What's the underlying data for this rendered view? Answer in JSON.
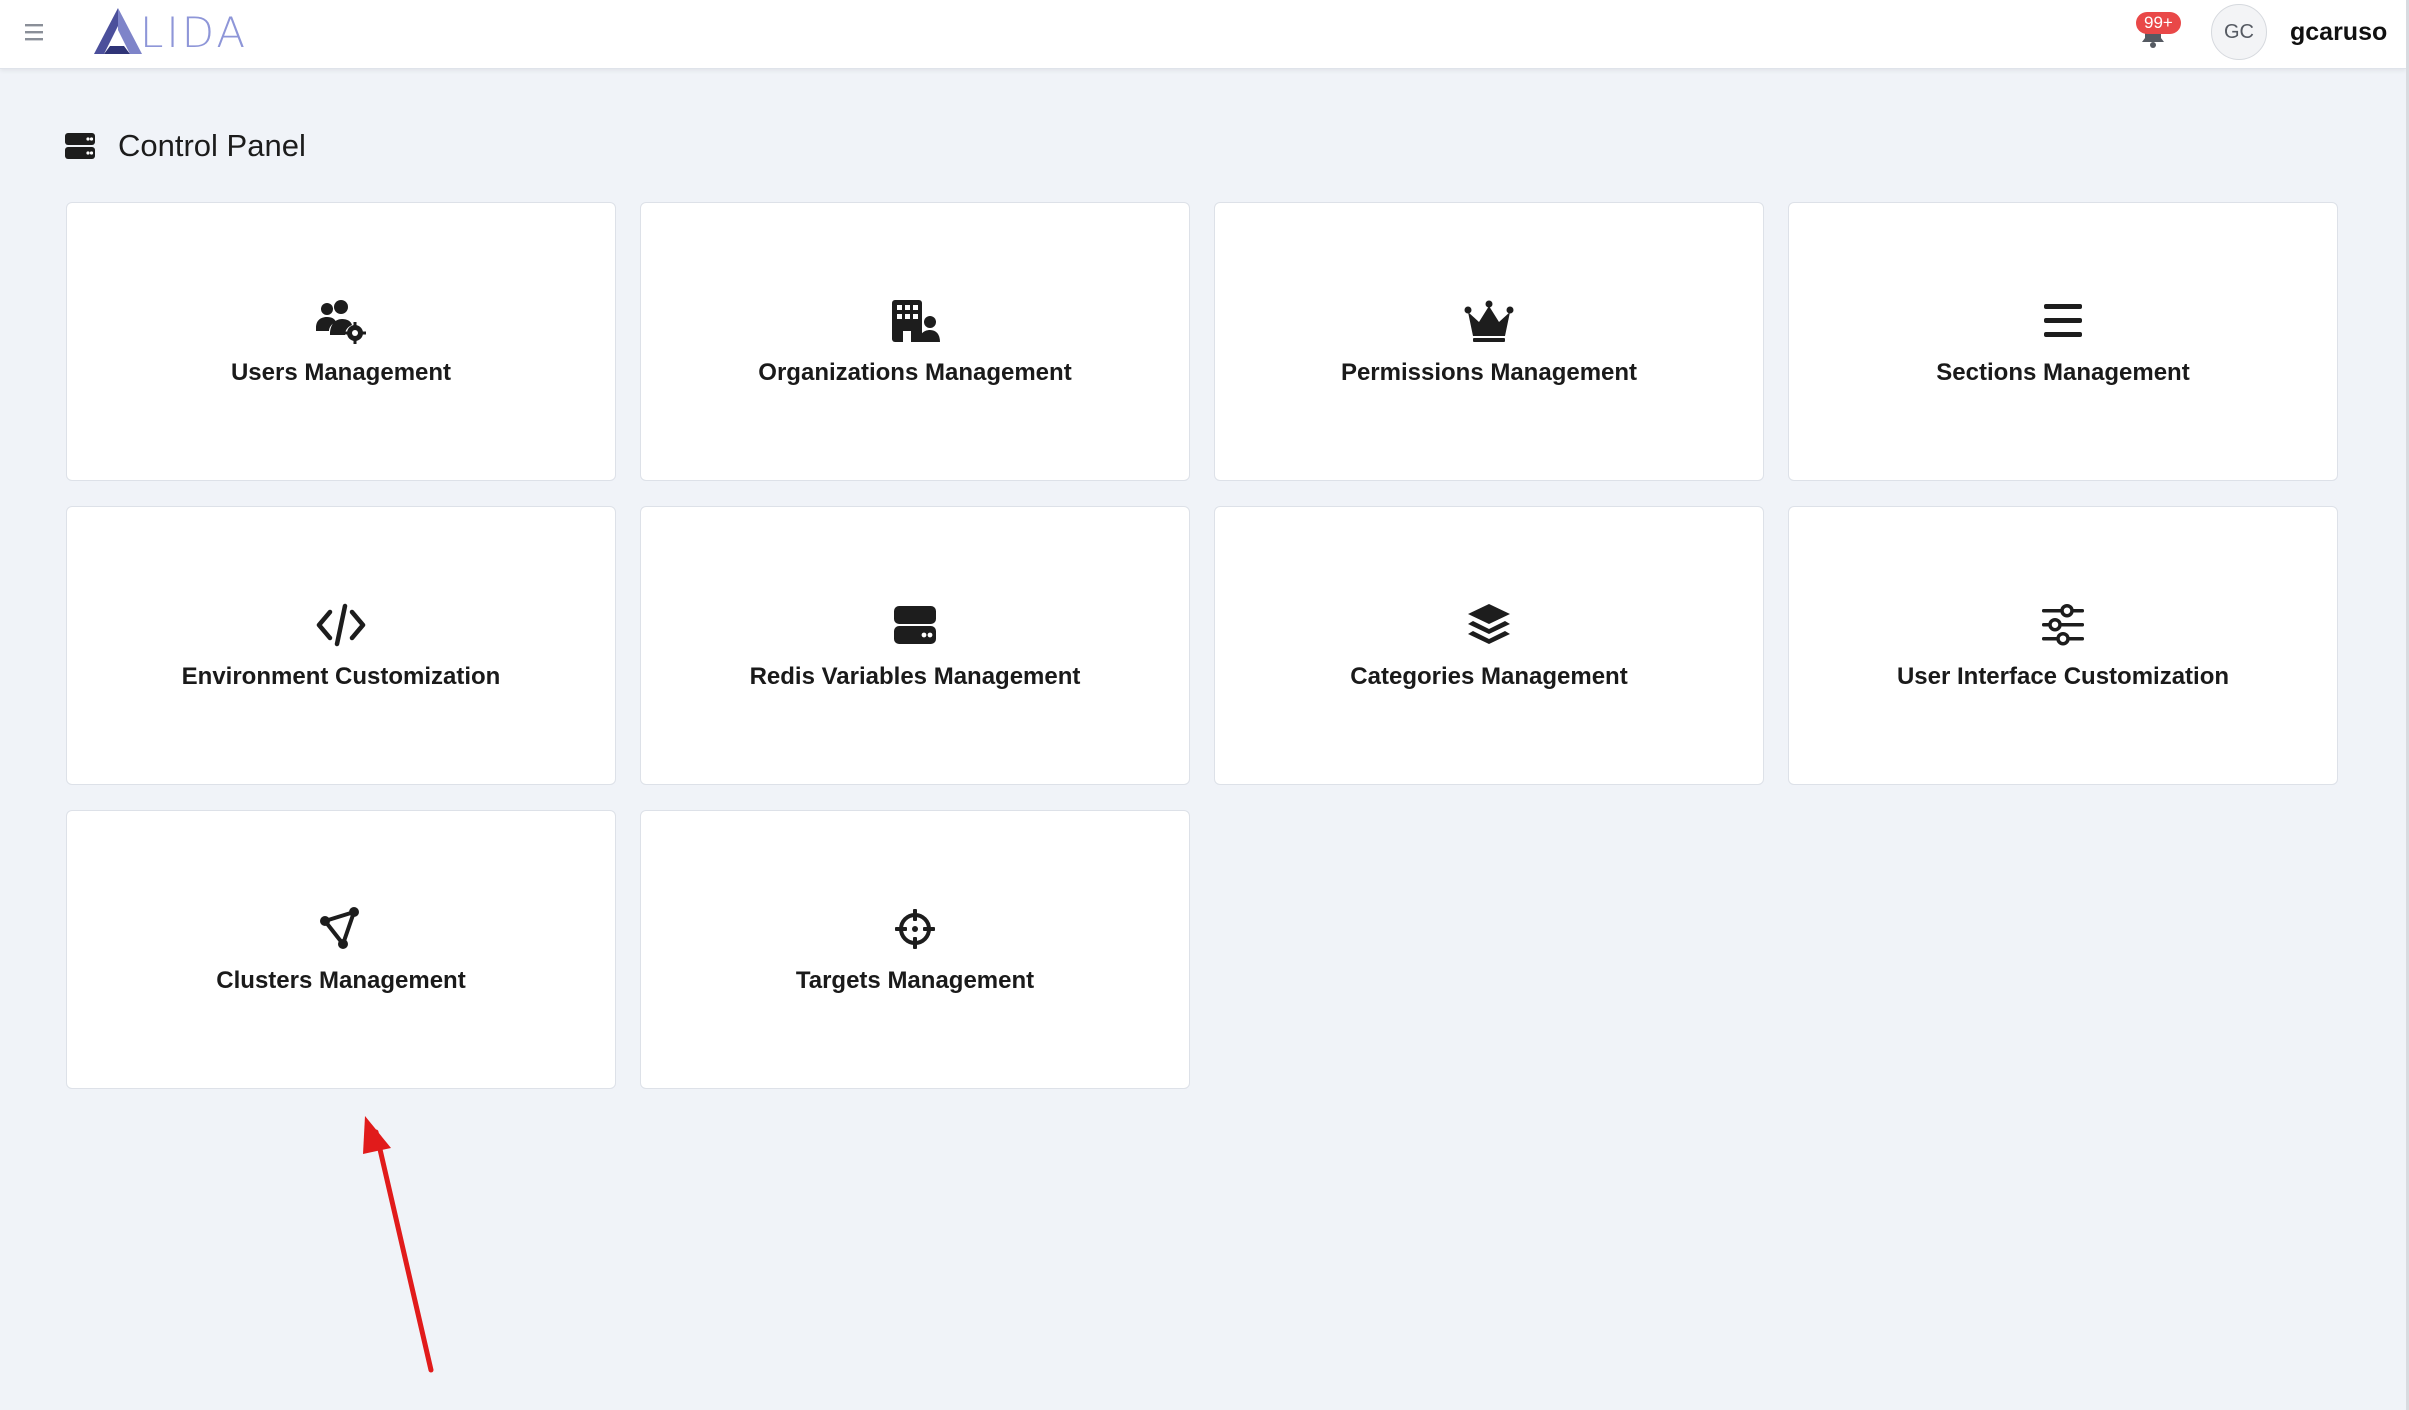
{
  "header": {
    "logo_text": "LIDA",
    "notification_badge": "99+",
    "avatar_initials": "GC",
    "username": "gcaruso"
  },
  "page": {
    "title": "Control Panel"
  },
  "cards": [
    {
      "label": "Users Management",
      "icon": "users-cog-icon"
    },
    {
      "label": "Organizations Management",
      "icon": "building-user-icon"
    },
    {
      "label": "Permissions Management",
      "icon": "crown-icon"
    },
    {
      "label": "Sections Management",
      "icon": "bars-icon"
    },
    {
      "label": "Environment Customization",
      "icon": "code-icon"
    },
    {
      "label": "Redis Variables Management",
      "icon": "server-icon"
    },
    {
      "label": "Categories Management",
      "icon": "layers-icon"
    },
    {
      "label": "User Interface Customization",
      "icon": "sliders-icon"
    },
    {
      "label": "Clusters Management",
      "icon": "cluster-nodes-icon"
    },
    {
      "label": "Targets Management",
      "icon": "crosshairs-icon"
    }
  ],
  "annotation": {
    "arrow_color": "#e11b1b"
  }
}
